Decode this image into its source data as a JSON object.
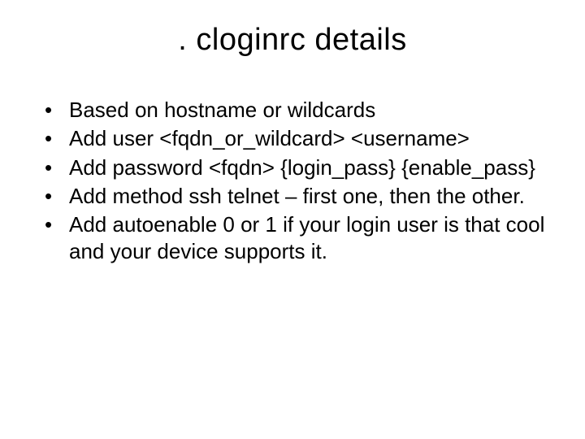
{
  "slide": {
    "title": ". cloginrc details",
    "bullets": [
      {
        "text": "Based on hostname or wildcards"
      },
      {
        "text": "Add user <fqdn_or_wildcard> <username>"
      },
      {
        "text": "Add password <fqdn> {login_pass} {enable_pass}"
      },
      {
        "text": "Add method ssh telnet – first one, then the other."
      },
      {
        "text": "Add autoenable 0 or 1 if your login user is that cool and your device supports it."
      }
    ]
  }
}
